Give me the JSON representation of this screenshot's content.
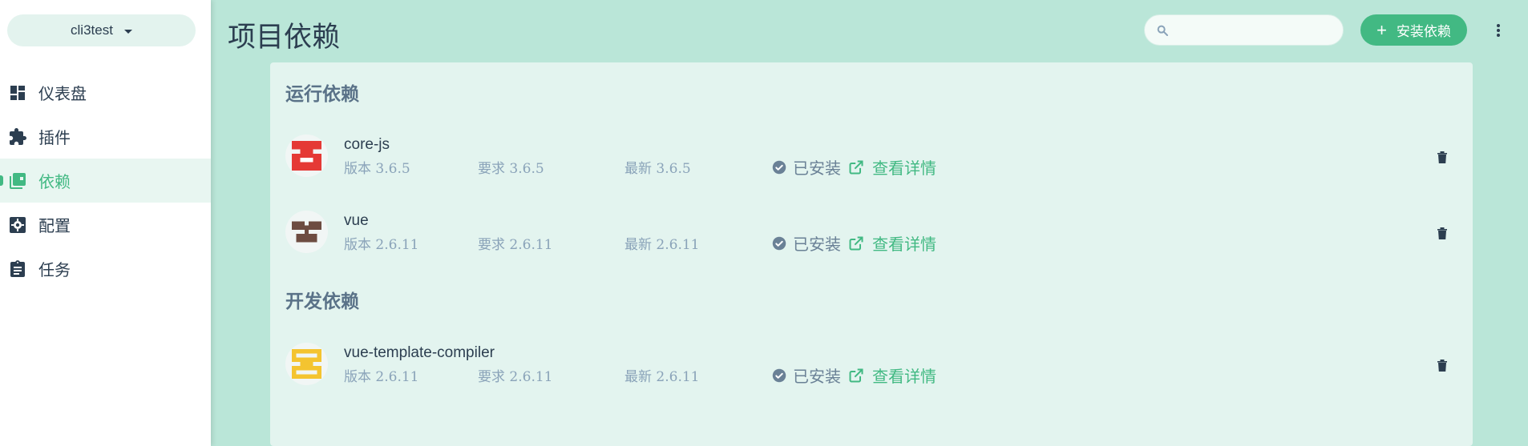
{
  "sidebar": {
    "project": "cli3test",
    "items": [
      {
        "label": "仪表盘",
        "icon": "dashboard-icon"
      },
      {
        "label": "插件",
        "icon": "puzzle-icon"
      },
      {
        "label": "依赖",
        "icon": "library-icon",
        "active": true
      },
      {
        "label": "配置",
        "icon": "settings-icon"
      },
      {
        "label": "任务",
        "icon": "clipboard-icon"
      }
    ]
  },
  "header": {
    "title": "项目依赖",
    "search_placeholder": "",
    "install_label": "安装依赖"
  },
  "sections": [
    {
      "title": "运行依赖",
      "deps": [
        {
          "name": "core-js",
          "version": "版本 3.6.5",
          "required": "要求 3.6.5",
          "latest": "最新 3.6.5",
          "status": "已安装",
          "details": "查看详情",
          "avatar_color": "#e53935"
        },
        {
          "name": "vue",
          "version": "版本 2.6.11",
          "required": "要求 2.6.11",
          "latest": "最新 2.6.11",
          "status": "已安装",
          "details": "查看详情",
          "avatar_color": "#6d4c41"
        }
      ]
    },
    {
      "title": "开发依赖",
      "deps": [
        {
          "name": "vue-template-compiler",
          "version": "版本 2.6.11",
          "required": "要求 2.6.11",
          "latest": "最新 2.6.11",
          "status": "已安装",
          "details": "查看详情",
          "avatar_color": "#f4c430"
        }
      ]
    }
  ],
  "colors": {
    "accent": "#42b983",
    "background": "#bae6d8",
    "panel": "#e3f4ef",
    "text": "#2c3e50",
    "muted": "#8aa3b9"
  }
}
